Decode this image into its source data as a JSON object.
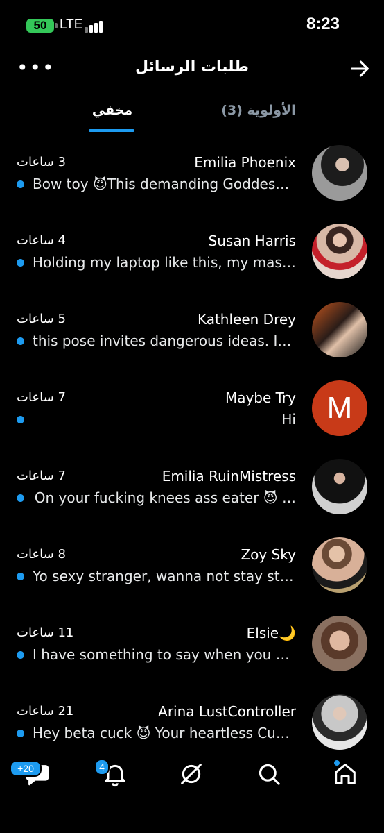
{
  "status_bar": {
    "battery": "50",
    "carrier": "LTE",
    "time": "8:23"
  },
  "header": {
    "title": "طلبات الرسائل"
  },
  "tabs": [
    {
      "label": "مخفي",
      "active": true
    },
    {
      "label": "الأولوية (3)",
      "active": false
    }
  ],
  "conversations": [
    {
      "name": "Emilia Phoenix",
      "time": "3 ساعات",
      "preview": "Bow toy 😈This demanding Goddess is …",
      "avatar": "photo"
    },
    {
      "name": "Susan Harris",
      "time": "4 ساعات",
      "preview": "Holding my laptop like this, my massive…",
      "avatar": "photo"
    },
    {
      "name": "Kathleen Drey",
      "time": "5 ساعات",
      "preview": "this pose invites dangerous ideas. It's…",
      "avatar": "photo"
    },
    {
      "name": "Maybe Try",
      "time": "7 ساعات",
      "preview": "Hi",
      "avatar": "M"
    },
    {
      "name": "Emilia RuinMistress",
      "time": "7 ساعات",
      "preview": "On your fucking knees ass eater 😈 …",
      "avatar": "photo"
    },
    {
      "name": "Zoy Sky",
      "time": "8 ساعات",
      "preview": "Yo sexy stranger, wanna not stay strangers…",
      "avatar": "photo"
    },
    {
      "name": "Elsie🌙",
      "time": "11 ساعات",
      "preview": "I have something to say when you see…",
      "avatar": "photo"
    },
    {
      "name": "Arina LustController",
      "time": "21 ساعات",
      "preview": "Hey beta cuck 😈 Your heartless Cuckoldress…",
      "avatar": "photo"
    }
  ],
  "tabbar": {
    "messages_badge": "+20",
    "notifications_badge": "4"
  },
  "colors": {
    "accent": "#1d9bf0",
    "avatar_m": "#c83a18"
  }
}
